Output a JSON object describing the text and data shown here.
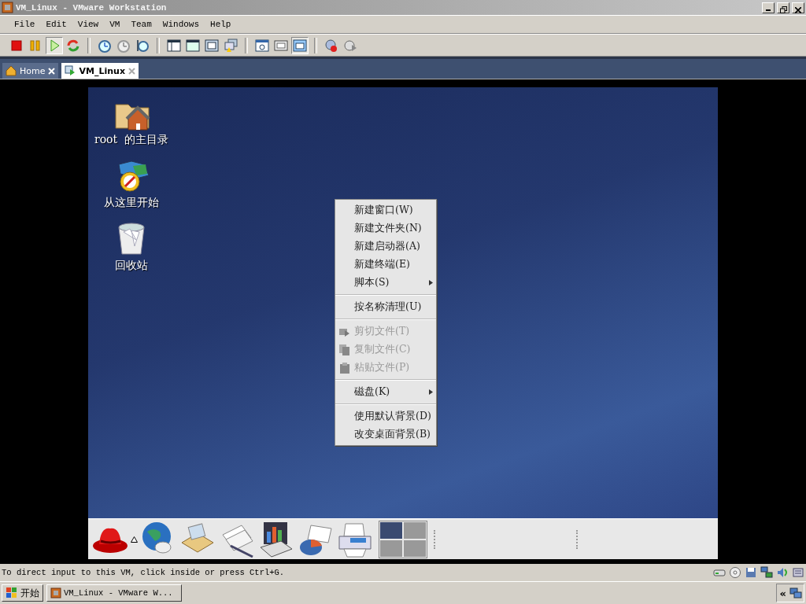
{
  "window": {
    "title": "VM_Linux - VMware Workstation"
  },
  "menu_bar": [
    "File",
    "Edit",
    "View",
    "VM",
    "Team",
    "Windows",
    "Help"
  ],
  "tabs": [
    {
      "label": "Home",
      "selected": false
    },
    {
      "label": "VM_Linux",
      "selected": true
    }
  ],
  "desktop_icons": [
    {
      "kind": "home",
      "label": "root  的主目录"
    },
    {
      "kind": "start",
      "label": "从这里开始"
    },
    {
      "kind": "trash",
      "label": "回收站"
    }
  ],
  "context_menu": [
    {
      "kind": "item",
      "label": "新建窗口(W)",
      "disabled": false,
      "submenu": false
    },
    {
      "kind": "item",
      "label": "新建文件夹(N)",
      "disabled": false,
      "submenu": false
    },
    {
      "kind": "item",
      "label": "新建启动器(A)",
      "disabled": false,
      "submenu": false
    },
    {
      "kind": "item",
      "label": "新建终端(E)",
      "disabled": false,
      "submenu": false
    },
    {
      "kind": "item",
      "label": "脚本(S)",
      "disabled": false,
      "submenu": true
    },
    {
      "kind": "separator"
    },
    {
      "kind": "item",
      "label": "按名称清理(U)",
      "disabled": false,
      "submenu": false
    },
    {
      "kind": "separator"
    },
    {
      "kind": "item",
      "label": "剪切文件(T)",
      "disabled": true,
      "submenu": false
    },
    {
      "kind": "item",
      "label": "复制文件(C)",
      "disabled": true,
      "submenu": false
    },
    {
      "kind": "item",
      "label": "粘贴文件(P)",
      "disabled": true,
      "submenu": false
    },
    {
      "kind": "separator"
    },
    {
      "kind": "item",
      "label": "磁盘(K)",
      "disabled": false,
      "submenu": true
    },
    {
      "kind": "separator"
    },
    {
      "kind": "item",
      "label": "使用默认背景(D)",
      "disabled": false,
      "submenu": false
    },
    {
      "kind": "item",
      "label": "改变桌面背景(B)",
      "disabled": false,
      "submenu": false
    }
  ],
  "status_bar": {
    "text": "To direct input to this VM, click inside or press Ctrl+G."
  },
  "taskbar": {
    "start": "开始",
    "task": "VM_Linux - VMware W...",
    "tray_toggle": "«"
  }
}
